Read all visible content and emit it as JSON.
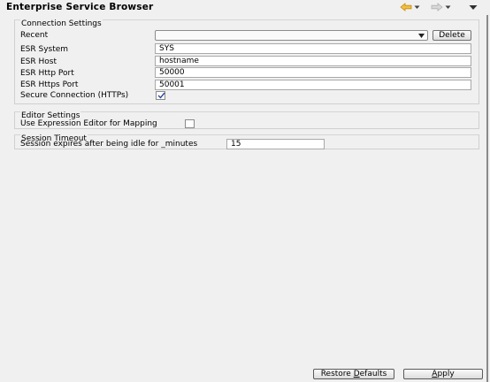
{
  "window": {
    "title": "Enterprise Service Browser"
  },
  "icons": {
    "back": "back-arrow-icon",
    "forward": "forward-arrow-icon",
    "menu": "view-menu-icon"
  },
  "connection": {
    "heading": "Connection Settings",
    "recent_label": "Recent",
    "recent_value": "",
    "delete_label": "Delete",
    "system_label": "ESR System",
    "system_value": "SYS",
    "host_label": "ESR Host",
    "host_value": "hostname",
    "http_port_label": "ESR Http Port",
    "http_port_value": "50000",
    "https_port_label": "ESR Https Port",
    "https_port_value": "50001",
    "secure_label": "Secure Connection (HTTPs)",
    "secure_checked": true
  },
  "editor": {
    "heading": "Editor Settings",
    "expression_label": "Use Expression Editor for Mapping",
    "expression_checked": false
  },
  "session": {
    "heading": "Session Timeout",
    "idle_label": "Session expires after being idle for _minutes",
    "idle_value": "15"
  },
  "buttons": {
    "restore_pre": "Restore ",
    "restore_ul": "D",
    "restore_post": "efaults",
    "apply_ul": "A",
    "apply_post": "pply"
  },
  "colors": {
    "back_arrow": "#e8a317",
    "disabled_arrow": "#b8b8b8",
    "checkmark": "#2a4a9a"
  }
}
